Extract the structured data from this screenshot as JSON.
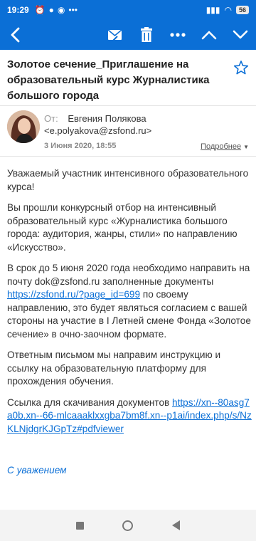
{
  "status": {
    "time": "19:29",
    "battery": "56"
  },
  "colors": {
    "brand": "#0b6fd6",
    "link": "#0b6fd6"
  },
  "toolbar": {
    "icons": [
      "back-arrow-icon",
      "reply-icon",
      "trash-icon",
      "more-dots-icon",
      "chevron-up-icon",
      "chevron-down-icon"
    ]
  },
  "message": {
    "subject": "Золотое сечение_Приглашение на образовательный курс Журналистика большого города",
    "from_label": "От:",
    "sender_name": "Евгения Полякова",
    "sender_email": "<e.polyakova@zsfond.ru>",
    "date": "3 Июня 2020, 18:55",
    "more_label": "Подробнее",
    "body": {
      "p1": "Уважаемый участник интенсивного образовательного курса!",
      "p2": "Вы прошли конкурсный отбор на интенсивный образовательный курс «Журналистика большого города: аудитория, жанры, стили» по направлению «Искусство».",
      "p3_before": "В срок до 5 июня 2020 года необходимо направить на почту dok@zsfond.ru  заполненные документы ",
      "p3_link": "https://zsfond.ru/?page_id=699",
      "p3_after": " по своему направлению, это будет являться согласием с вашей стороны на участие в I Летней смене Фонда «Золотое сечение» в очно-заочном формате.",
      "p4": "Ответным письмом мы направим инструкцию и ссылку на образовательную платформу для прохождения обучения.",
      "p5_label": "Ссылка для скачивания документов ",
      "p5_link": "https://xn--80asg7a0b.xn--66-mlcaaaklxxgba7bm8f.xn--p1ai/index.php/s/NzKLNjdgrKJGpTz#pdfviewer",
      "signoff": "С уважением"
    }
  }
}
